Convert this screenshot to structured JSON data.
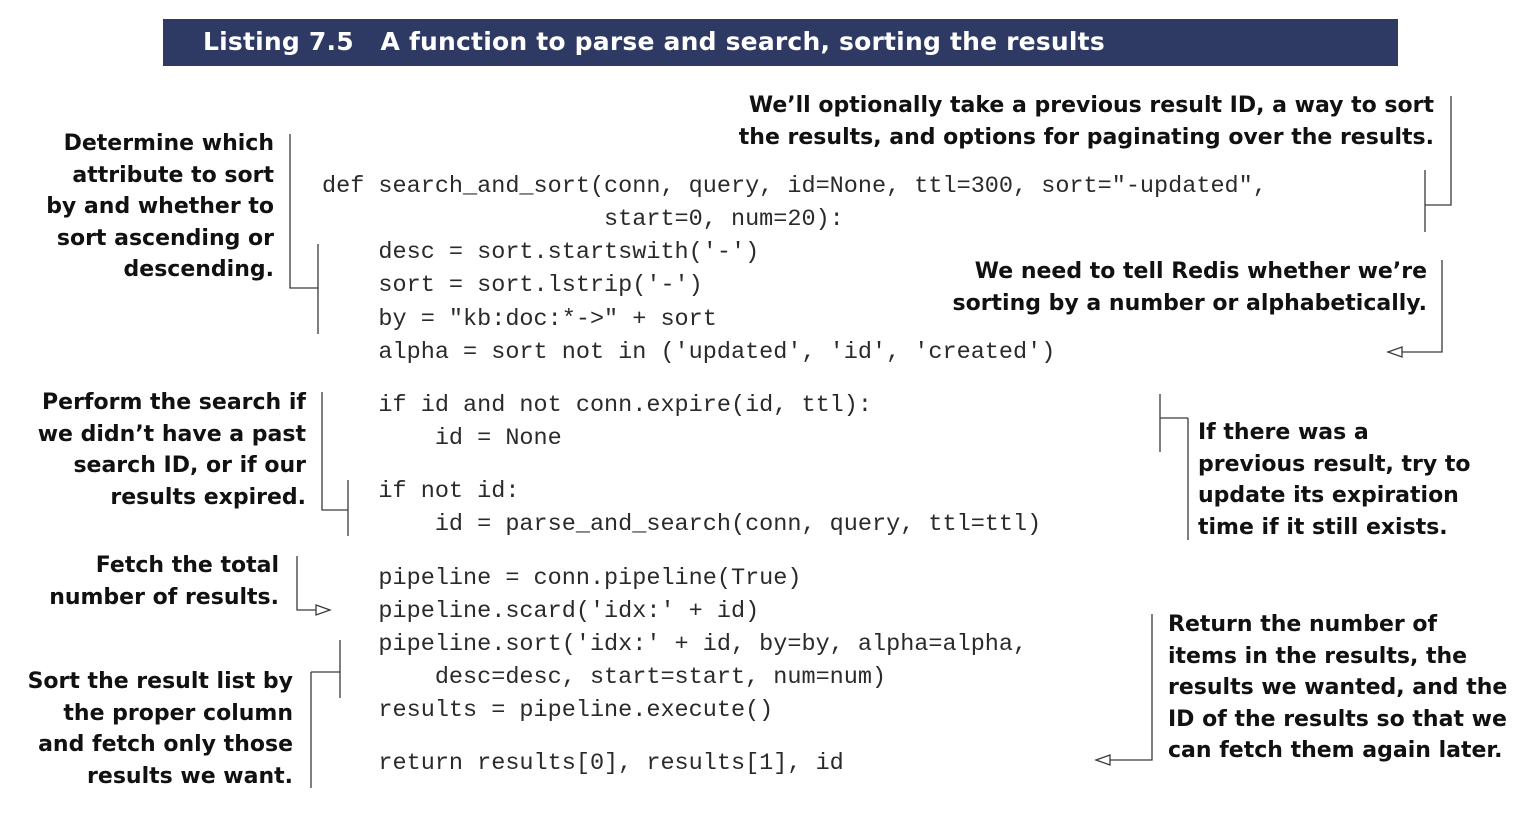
{
  "listing": {
    "label": "Listing 7.5",
    "title": "A function to parse and search, sorting the results"
  },
  "code_lines": [
    "def search_and_sort(conn, query, id=None, ttl=300, sort=\"-updated\",",
    "                    start=0, num=20):",
    "    desc = sort.startswith('-')",
    "    sort = sort.lstrip('-')",
    "    by = \"kb:doc:*->\" + sort",
    "    alpha = sort not in ('updated', 'id', 'created')",
    "    if id and not conn.expire(id, ttl):",
    "        id = None",
    "    if not id:",
    "        id = parse_and_search(conn, query, ttl=ttl)",
    "    pipeline = conn.pipeline(True)",
    "    pipeline.scard('idx:' + id)",
    "    pipeline.sort('idx:' + id, by=by, alpha=alpha,",
    "        desc=desc, start=start, num=num)",
    "    results = pipeline.execute()",
    "    return results[0], results[1], id"
  ],
  "annotations": {
    "optional_args": "We’ll optionally take a previous result ID, a way to sort\nthe results, and options for paginating over the results.",
    "determine_sort": "Determine which\nattribute to sort\nby and whether to\nsort ascending or\ndescending.",
    "tell_redis": "We need to tell Redis whether we’re\nsorting by a number or alphabetically.",
    "perform_search": "Perform the search if\nwe didn’t have a past\nsearch ID, or if our\nresults expired.",
    "update_expiration": "If there was a\nprevious result, try to\nupdate its expiration\ntime if it still exists.",
    "fetch_total": "Fetch the total\nnumber of results.",
    "sort_results": "Sort the result list by\nthe proper column\nand fetch only those\nresults we want.",
    "return_results": "Return the number of\nitems in the results, the\nresults we wanted, and the\nID of the results so that we\ncan fetch them again later."
  }
}
